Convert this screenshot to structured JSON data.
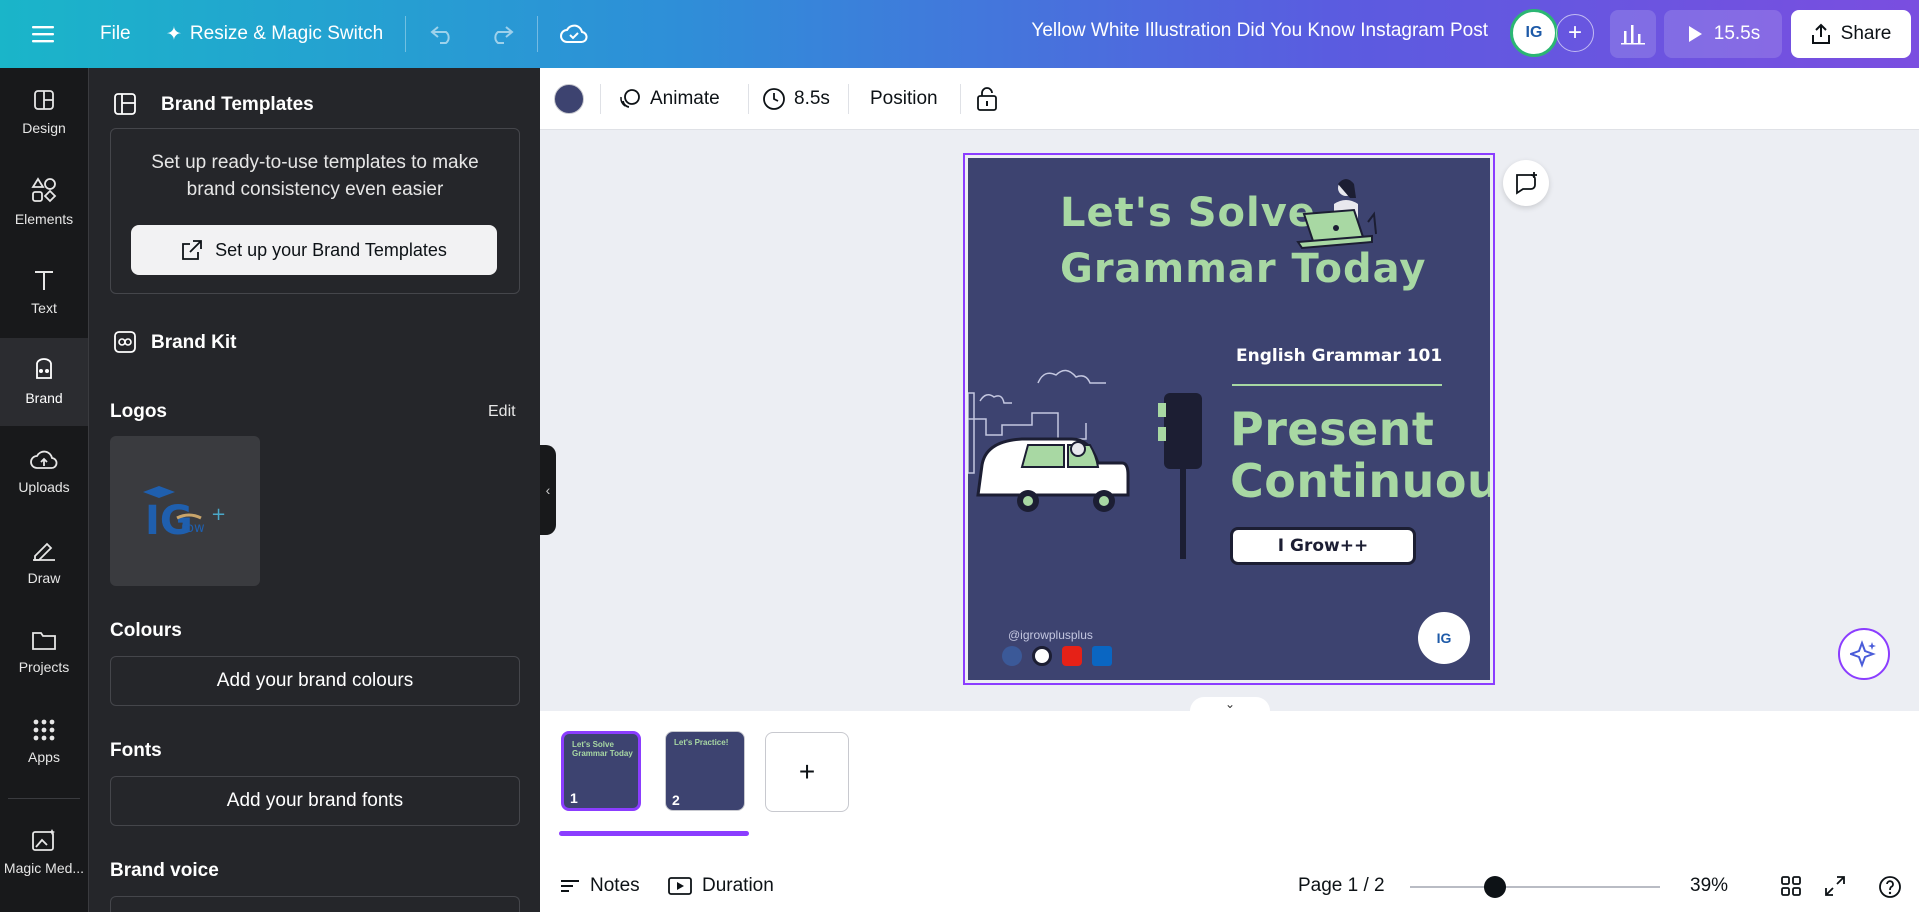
{
  "topbar": {
    "file_label": "File",
    "resize_label": "Resize & Magic Switch",
    "doc_title": "Yellow White Illustration Did You Know Instagram Post",
    "avatar_text": "IG",
    "play_label": "15.5s",
    "share_label": "Share"
  },
  "rail": {
    "items": [
      {
        "label": "Design",
        "icon": "design-icon"
      },
      {
        "label": "Elements",
        "icon": "elements-icon"
      },
      {
        "label": "Text",
        "icon": "text-icon"
      },
      {
        "label": "Brand",
        "icon": "brand-icon"
      },
      {
        "label": "Uploads",
        "icon": "uploads-icon"
      },
      {
        "label": "Draw",
        "icon": "draw-icon"
      },
      {
        "label": "Projects",
        "icon": "projects-icon"
      },
      {
        "label": "Apps",
        "icon": "apps-icon"
      },
      {
        "label": "Magic Med...",
        "icon": "magic-media-icon"
      }
    ],
    "active": "Brand"
  },
  "panel": {
    "brand_templates_title": "Brand Templates",
    "brand_templates_desc": "Set up ready-to-use templates to make brand consistency even easier",
    "setup_button": "Set up your Brand Templates",
    "brand_kit_title": "Brand Kit",
    "logos_title": "Logos",
    "logos_edit": "Edit",
    "colours_title": "Colours",
    "colours_button": "Add your brand colours",
    "fonts_title": "Fonts",
    "fonts_button": "Add your brand fonts",
    "brand_voice_title": "Brand voice"
  },
  "context_toolbar": {
    "color": "#3d4370",
    "animate_label": "Animate",
    "duration_label": "8.5s",
    "position_label": "Position"
  },
  "design": {
    "title_line1": "Let's Solve",
    "title_line2": "Grammar Today",
    "subtitle": "English Grammar 101",
    "big_line1": "Present",
    "big_line2": "Continuous",
    "pill": "I Grow++",
    "handle": "@igrowplusplus",
    "logo_text": "IG",
    "bg_color": "#3d4370",
    "accent_color": "#a8d8a3"
  },
  "pages": {
    "thumbs": [
      {
        "num": "1",
        "title": "Let's Solve Grammar Today",
        "active": true
      },
      {
        "num": "2",
        "title": "Let's Practice!",
        "active": false
      }
    ]
  },
  "footer": {
    "notes_label": "Notes",
    "duration_label": "Duration",
    "page_indicator": "Page 1 / 2",
    "zoom": "39%"
  }
}
